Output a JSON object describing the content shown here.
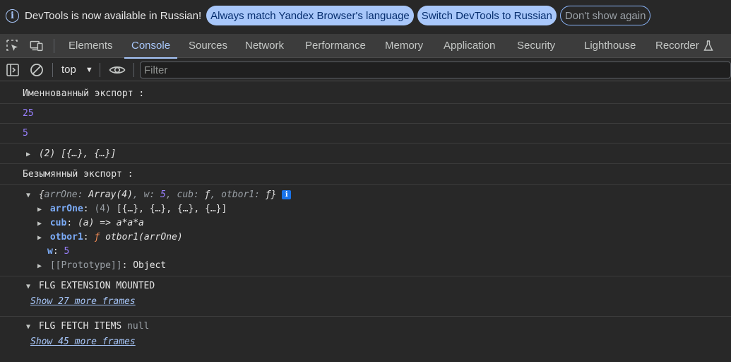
{
  "infobar": {
    "message": "DevTools is now available in Russian!",
    "match_language_label": "Always match Yandex Browser's language",
    "switch_label": "Switch DevTools to Russian",
    "dismiss_label": "Don't show again"
  },
  "tabs": [
    "Elements",
    "Console",
    "Sources",
    "Network",
    "Performance",
    "Memory",
    "Application",
    "Security",
    "Lighthouse",
    "Recorder"
  ],
  "active_tab": "Console",
  "toolbar": {
    "context": "top",
    "filter_placeholder": "Filter"
  },
  "console": {
    "named_export_label": "Именнованный экспорт :",
    "value_25": "25",
    "value_5": "5",
    "array_summary": "(2) [{…}, {…}]",
    "default_export_label": "Безымянный экспорт :",
    "object_summary": {
      "open": "{",
      "k1": "arrOne",
      "v1": "Array(4)",
      "k2": "w",
      "v2": "5",
      "k3": "cub",
      "v3": "ƒ",
      "k4": "otbor1",
      "v4": "ƒ",
      "close": "}"
    },
    "props": {
      "arrOne_key": "arrOne",
      "arrOne_count": "(4)",
      "arrOne_value": "[{…}, {…}, {…}, {…}]",
      "cub_key": "cub",
      "cub_value": "(a) => a*a*a",
      "otbor1_key": "otbor1",
      "otbor1_f": "ƒ",
      "otbor1_value": "otbor1(arrOne)",
      "w_key": "w",
      "w_value": "5",
      "prototype_key": "[[Prototype]]",
      "prototype_value": "Object"
    },
    "group1_label": "FLG EXTENSION MOUNTED",
    "group1_frames": "Show 27 more frames",
    "group2_label": "FLG FETCH ITEMS",
    "group2_null": "null",
    "group2_frames": "Show 45 more frames"
  }
}
